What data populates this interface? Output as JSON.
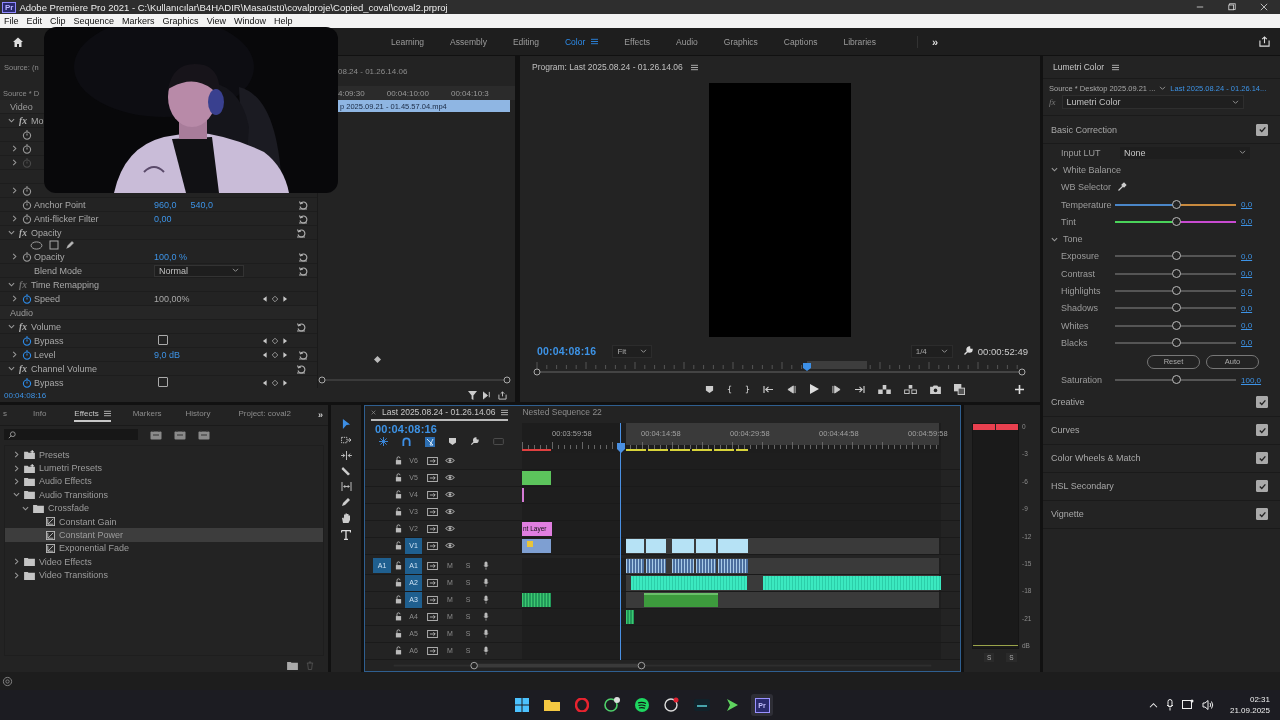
{
  "window": {
    "icon": "Pr",
    "title": "Adobe Premiere Pro 2021 - C:\\Kullanıcılar\\B4HADIR\\Masaüstü\\covalproje\\Copied_coval\\coval2.prproj"
  },
  "menu": [
    "File",
    "Edit",
    "Clip",
    "Sequence",
    "Markers",
    "Graphics",
    "View",
    "Window",
    "Help"
  ],
  "workspaces": [
    {
      "label": "Learning",
      "selected": false
    },
    {
      "label": "Assembly",
      "selected": false
    },
    {
      "label": "Editing",
      "selected": false
    },
    {
      "label": "Color",
      "selected": true
    },
    {
      "label": "Effects",
      "selected": false
    },
    {
      "label": "Audio",
      "selected": false
    },
    {
      "label": "Graphics",
      "selected": false
    },
    {
      "label": "Captions",
      "selected": false
    },
    {
      "label": "Libraries",
      "selected": false
    }
  ],
  "workspace_overflow": "»",
  "effect_controls": {
    "source_tab": "Source: (n",
    "sequence": "08.24 - 01.26.14.06",
    "clip_source": "Source * D",
    "ruler": [
      "4:09:30",
      "00:04:10:00",
      "00:04:10:3"
    ],
    "clip": "p 2025.09.21 - 01.45.57.04.mp4",
    "timecode": "00:04:08:16",
    "rows": [
      {
        "kind": "section",
        "label": "Video"
      },
      {
        "kind": "effect",
        "badge": "fx",
        "label": "Mo",
        "expanded": true
      },
      {
        "kind": "property"
      },
      {
        "kind": "property",
        "expandable": true
      },
      {
        "kind": "property",
        "expandable": true,
        "disabled": true
      },
      {
        "kind": "blank"
      },
      {
        "kind": "property",
        "expandable": true
      },
      {
        "kind": "property",
        "label": "Anchor Point",
        "values": [
          "960,0",
          "540,0"
        ],
        "reset": true
      },
      {
        "kind": "property",
        "expandable": true,
        "label": "Anti-flicker Filter",
        "values": [
          "0,00"
        ],
        "reset": true
      },
      {
        "kind": "effect",
        "badge": "fx",
        "label": "Opacity",
        "expanded": true,
        "reset": true
      },
      {
        "kind": "masks"
      },
      {
        "kind": "property",
        "expandable": true,
        "label": "Opacity",
        "values": [
          "100,0 %"
        ],
        "reset": true
      },
      {
        "kind": "select",
        "label": "Blend Mode",
        "value": "Normal",
        "reset": true
      },
      {
        "kind": "effect",
        "badge": "fx",
        "label": "Time Remapping",
        "expanded": true,
        "disabled": true
      },
      {
        "kind": "property",
        "expandable": true,
        "animated": true,
        "disabled": true,
        "label": "Speed",
        "values": [
          "100,00%"
        ],
        "keyframes": true
      },
      {
        "kind": "section",
        "label": "Audio"
      },
      {
        "kind": "effect",
        "badge": "fx",
        "label": "Volume",
        "expanded": true,
        "reset": true
      },
      {
        "kind": "checkbox",
        "animated": true,
        "label": "Bypass",
        "checked": false,
        "keyframes": true
      },
      {
        "kind": "property",
        "expandable": true,
        "animated": true,
        "label": "Level",
        "values": [
          "9,0 dB"
        ],
        "keyframes": true,
        "reset": true
      },
      {
        "kind": "effect",
        "badge": "fx",
        "label": "Channel Volume",
        "expanded": true,
        "reset": true
      },
      {
        "kind": "checkbox",
        "animated": true,
        "label": "Bypass",
        "checked": false,
        "keyframes": true
      }
    ]
  },
  "program": {
    "title": "Program: Last 2025.08.24 - 01.26.14.06",
    "timecode": "00:04:08:16",
    "zoom": "Fit",
    "resolution": "1/4",
    "duration": "00:00:52:49"
  },
  "lumetri": {
    "title": "Lumetri Color",
    "source": "Source * Desktop 2025.09.21 ...",
    "sequence": "Last 2025.08.24 - 01.26.14...",
    "badge": "fx",
    "effect": "Lumetri Color",
    "rows": [
      {
        "kind": "section",
        "label": "Basic Correction",
        "checked": true
      },
      {
        "kind": "dropdown",
        "label": "Input LUT",
        "value": "None"
      },
      {
        "kind": "group",
        "label": "White Balance",
        "expanded": true
      },
      {
        "kind": "picker",
        "label": "WB Selector"
      },
      {
        "kind": "temperature-slider",
        "label": "Temperature",
        "level": 0.5,
        "reading": "0,0"
      },
      {
        "kind": "tint-slider",
        "label": "Tint",
        "level": 0.5,
        "reading": "0,0"
      },
      {
        "kind": "group",
        "label": "Tone",
        "expanded": true
      },
      {
        "kind": "slider",
        "label": "Exposure",
        "level": 0.5,
        "reading": "0,0"
      },
      {
        "kind": "slider",
        "label": "Contrast",
        "level": 0.5,
        "reading": "0,0"
      },
      {
        "kind": "slider",
        "label": "Highlights",
        "level": 0.5,
        "reading": "0,0"
      },
      {
        "kind": "slider",
        "label": "Shadows",
        "level": 0.5,
        "reading": "0,0"
      },
      {
        "kind": "slider",
        "label": "Whites",
        "level": 0.5,
        "reading": "0,0"
      },
      {
        "kind": "slider",
        "label": "Blacks",
        "level": 0.5,
        "reading": "0,0"
      },
      {
        "kind": "buttons",
        "labels": [
          "Reset",
          "Auto"
        ]
      },
      {
        "kind": "slider",
        "label": "Saturation",
        "level": 0.5,
        "reading": "100,0"
      },
      {
        "kind": "section",
        "label": "Creative",
        "checked": true
      },
      {
        "kind": "section",
        "label": "Curves",
        "checked": true
      },
      {
        "kind": "section",
        "label": "Color Wheels & Match",
        "checked": true
      },
      {
        "kind": "section",
        "label": "HSL Secondary",
        "checked": true
      },
      {
        "kind": "section",
        "label": "Vignette",
        "checked": true
      }
    ]
  },
  "effects_panel": {
    "tabs": [
      {
        "label": "s",
        "selected": false
      },
      {
        "label": "Info",
        "selected": false
      },
      {
        "label": "Effects",
        "selected": true
      },
      {
        "label": "Markers",
        "selected": false
      },
      {
        "label": "History",
        "selected": false
      },
      {
        "label": "Project: coval2",
        "selected": false
      }
    ],
    "overflow": "»",
    "tree": [
      {
        "label": "Presets",
        "kind": "preset-bin",
        "expanded": false,
        "selected": false
      },
      {
        "label": "Lumetri Presets",
        "kind": "preset-bin",
        "expanded": false,
        "selected": false
      },
      {
        "label": "Audio Effects",
        "kind": "folder",
        "expanded": false,
        "selected": false
      },
      {
        "label": "Audio Transitions",
        "kind": "folder",
        "expanded": true,
        "selected": false,
        "children": [
          {
            "label": "Crossfade",
            "kind": "folder",
            "expanded": true,
            "selected": false,
            "children": [
              {
                "label": "Constant Gain",
                "kind": "transition",
                "selected": false
              },
              {
                "label": "Constant Power",
                "kind": "transition",
                "selected": true
              },
              {
                "label": "Exponential Fade",
                "kind": "transition",
                "selected": false
              }
            ]
          }
        ]
      },
      {
        "label": "Video Effects",
        "kind": "folder",
        "expanded": false,
        "selected": false
      },
      {
        "label": "Video Transitions",
        "kind": "folder",
        "expanded": false,
        "selected": false
      }
    ]
  },
  "timeline": {
    "tabs": [
      {
        "label": "Last 2025.08.24 - 01.26.14.06",
        "selected": true
      },
      {
        "label": "Nested Sequence 22",
        "selected": false
      }
    ],
    "timecode": "00:04:08:16",
    "ruler": [
      "00:03:59:58",
      "00:04:14:58",
      "00:04:29:58",
      "00:04:44:58",
      "00:04:59:58"
    ],
    "video_tracks": [
      {
        "name": "V6",
        "targeted": false
      },
      {
        "name": "V5",
        "targeted": false
      },
      {
        "name": "V4",
        "targeted": false
      },
      {
        "name": "V3",
        "targeted": false
      },
      {
        "name": "V2",
        "targeted": false
      },
      {
        "name": "V1",
        "targeted": true
      }
    ],
    "audio_tracks": [
      {
        "name": "A1",
        "targeted": true,
        "source": "A1",
        "mute": "M",
        "solo": "S"
      },
      {
        "name": "A2",
        "targeted": true,
        "mute": "M",
        "solo": "S"
      },
      {
        "name": "A3",
        "targeted": true,
        "mute": "M",
        "solo": "S"
      },
      {
        "name": "A4",
        "targeted": false,
        "mute": "M",
        "solo": "S"
      },
      {
        "name": "A5",
        "targeted": false,
        "mute": "M",
        "solo": "S"
      },
      {
        "name": "A6",
        "targeted": false,
        "mute": "M",
        "solo": "S"
      }
    ],
    "adjustment_clip": "nt Layer"
  },
  "meter": {
    "scale": [
      "0",
      "-3",
      "-6",
      "-9",
      "-12",
      "-15",
      "-18",
      "-21",
      "dB"
    ],
    "solo": [
      "S",
      "S"
    ]
  },
  "taskbar": {
    "app_label": "Pr",
    "time": "02:31",
    "date": "21.09.2025"
  }
}
